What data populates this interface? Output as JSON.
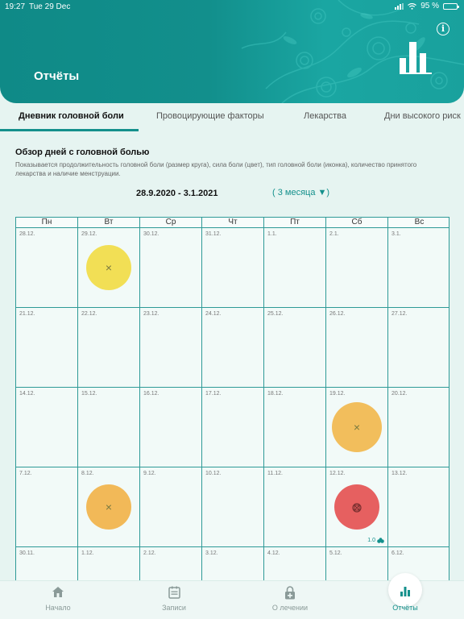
{
  "status_bar": {
    "time": "19:27",
    "date": "Tue 29 Dec",
    "battery": "95 %"
  },
  "header": {
    "title": "Отчёты",
    "info_icon": "info-icon",
    "header_icon": "bar-chart-icon",
    "accent": "#14908c"
  },
  "tabs": [
    {
      "label": "Дневник головной боли",
      "active": true
    },
    {
      "label": "Провоцирующие факторы",
      "active": false
    },
    {
      "label": "Лекарства",
      "active": false
    },
    {
      "label": "Дни высокого риск",
      "active": false
    }
  ],
  "overview": {
    "title": "Обзор дней с головной болью",
    "description": "Показывается продолжительность головной боли (размер круга), сила боли (цвет), тип головной боли (иконка), количество принятого лекарства и наличие менструации.",
    "date_range": "28.9.2020 - 3.1.2021",
    "period": "( 3 месяца ▼)"
  },
  "calendar": {
    "weekdays": [
      "Пн",
      "Вт",
      "Ср",
      "Чт",
      "Пт",
      "Сб",
      "Вс"
    ],
    "weeks": [
      [
        "28.12.",
        "29.12.",
        "30.12.",
        "31.12.",
        "1.1.",
        "2.1.",
        "3.1."
      ],
      [
        "21.12.",
        "22.12.",
        "23.12.",
        "24.12.",
        "25.12.",
        "26.12.",
        "27.12."
      ],
      [
        "14.12.",
        "15.12.",
        "16.12.",
        "17.12.",
        "18.12.",
        "19.12.",
        "20.12."
      ],
      [
        "7.12.",
        "8.12.",
        "9.12.",
        "10.12.",
        "11.12.",
        "12.12.",
        "13.12."
      ],
      [
        "30.11.",
        "1.12.",
        "2.12.",
        "3.12.",
        "4.12.",
        "5.12.",
        "6.12."
      ]
    ],
    "events": [
      {
        "week": 0,
        "day": 1,
        "color": "#f2df55",
        "size": 0.74,
        "icon": "cross-icon"
      },
      {
        "week": 2,
        "day": 5,
        "color": "#f2be5c",
        "size": 0.82,
        "icon": "cross-icon"
      },
      {
        "week": 3,
        "day": 1,
        "color": "#f2b958",
        "size": 0.74,
        "icon": "cross-icon"
      },
      {
        "week": 3,
        "day": 5,
        "color": "#e66060",
        "size": 0.74,
        "icon": "boxed-cross-icon",
        "medication": "1.0"
      }
    ]
  },
  "bottom_nav": [
    {
      "label": "Начало",
      "icon": "home-icon",
      "active": false
    },
    {
      "label": "Записи",
      "icon": "notes-icon",
      "active": false
    },
    {
      "label": "О лечении",
      "icon": "lock-plus-icon",
      "active": false
    },
    {
      "label": "Отчёты",
      "icon": "bar-chart-icon",
      "active": true
    }
  ]
}
